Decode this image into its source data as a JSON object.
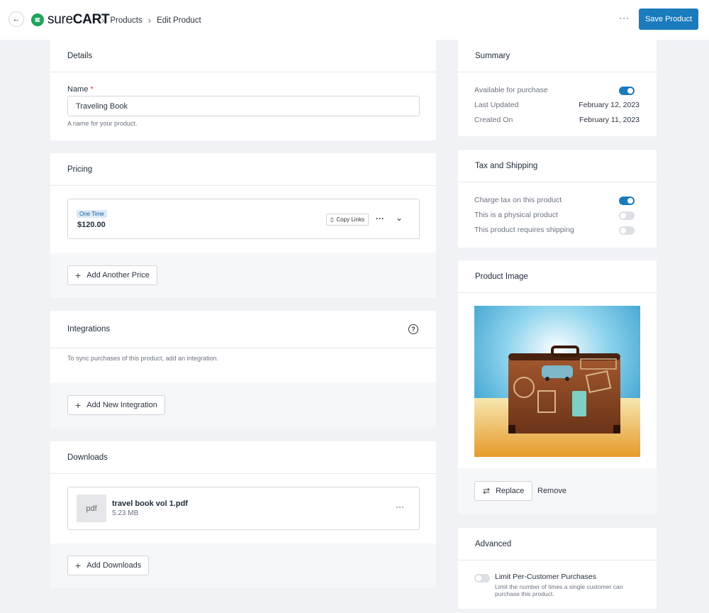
{
  "topbar": {
    "logo_text": "surecart",
    "crumbs": [
      "Products",
      "Edit Product"
    ],
    "more_label": "···",
    "save_label": "Save Product"
  },
  "details": {
    "title": "Details",
    "name_label": "Name",
    "required_mark": "*",
    "name_value": "Traveling Book",
    "name_help": "A name for your product."
  },
  "pricing": {
    "title": "Pricing",
    "price_badge": "One Time",
    "price_amount": "$120.00",
    "copy_links_label": "Copy Links",
    "add_price_label": "Add Another Price"
  },
  "integrations": {
    "title": "Integrations",
    "help_text": "To sync purchases of this product, add an integration.",
    "add_label": "Add New Integration"
  },
  "downloads": {
    "title": "Downloads",
    "file_type": "pdf",
    "file_name": "travel book vol 1.pdf",
    "file_size": "5.23 MB",
    "add_label": "Add Downloads"
  },
  "summary": {
    "title": "Summary",
    "available_label": "Available for purchase",
    "available_on": true,
    "last_updated_label": "Last Updated",
    "last_updated_value": "February 12, 2023",
    "created_label": "Created On",
    "created_value": "February 11, 2023"
  },
  "tax": {
    "title": "Tax and Shipping",
    "rows": [
      {
        "label": "Charge tax on this product",
        "on": true
      },
      {
        "label": "This is a physical product",
        "on": false
      },
      {
        "label": "This product requires shipping",
        "on": false
      }
    ]
  },
  "image": {
    "title": "Product Image",
    "replace_label": "Replace",
    "remove_label": "Remove"
  },
  "advanced": {
    "title": "Advanced",
    "limit_label": "Limit Per-Customer Purchases",
    "limit_help": "Limit the number of times a single customer can purchase this product.",
    "limit_on": false
  },
  "colors": {
    "primary": "#1a7bbd",
    "brand_green": "#1fa35a"
  }
}
